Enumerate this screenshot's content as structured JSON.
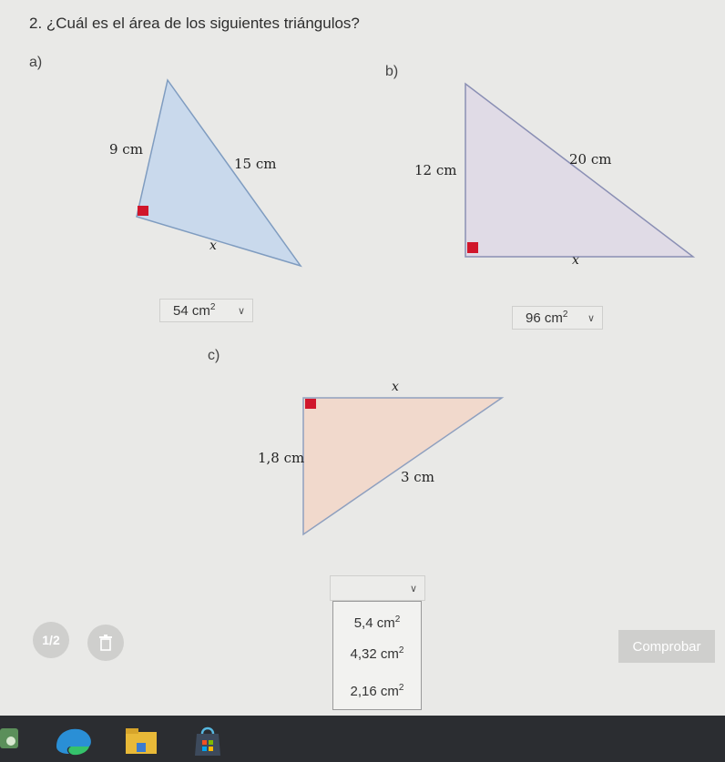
{
  "question": {
    "title": "2. ¿Cuál es el área de los siguientes triángulos?"
  },
  "part_a": {
    "label": "a)",
    "side_left": "9 cm",
    "side_hyp": "15 cm",
    "side_bottom": "x",
    "answer_value": "54 cm",
    "answer_exp": "2",
    "fill_color": "#c9d9ec"
  },
  "part_b": {
    "label": "b)",
    "side_left": "12 cm",
    "side_hyp": "20 cm",
    "side_bottom": "x",
    "answer_value": "96 cm",
    "answer_exp": "2",
    "fill_color": "#e0dbe6"
  },
  "part_c": {
    "label": "c)",
    "side_top": "x",
    "side_left": "1,8 cm",
    "side_hyp": "3 cm",
    "fill_color": "#f1d9cc",
    "options": [
      {
        "value": "5,4 cm",
        "exp": "2"
      },
      {
        "value": "4,32 cm",
        "exp": "2"
      },
      {
        "value": "2,16 cm",
        "exp": "2"
      }
    ]
  },
  "right_angle_color": "#d0162b",
  "footer": {
    "page_indicator": "1/2",
    "check_button": "Comprobar"
  }
}
